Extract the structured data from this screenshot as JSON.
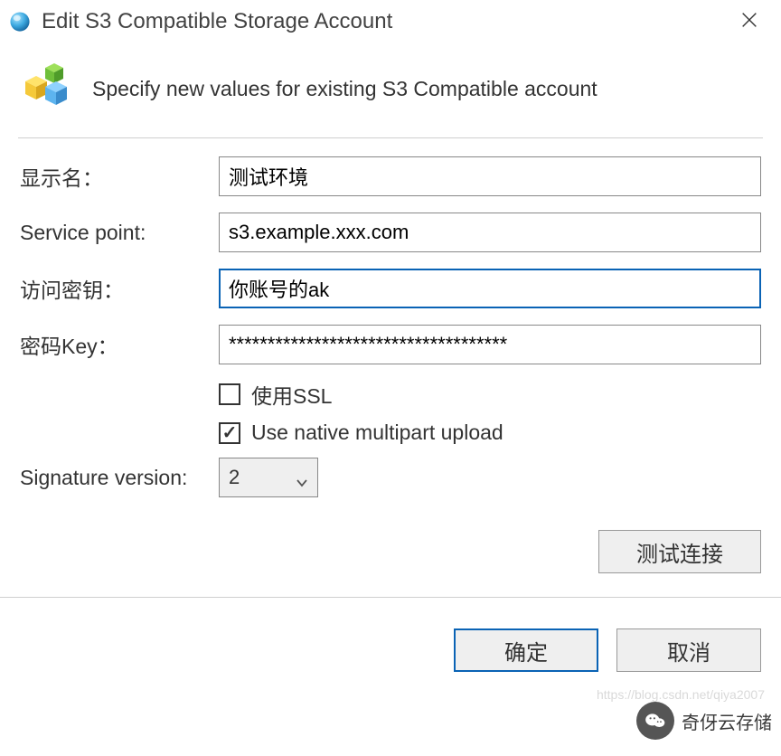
{
  "titlebar": {
    "title": "Edit S3 Compatible Storage Account"
  },
  "header": {
    "description": "Specify new values for existing S3 Compatible account"
  },
  "form": {
    "display_name": {
      "label": "显示名：",
      "value": "测试环境"
    },
    "service_point": {
      "label": "Service point:",
      "value": "s3.example.xxx.com"
    },
    "access_key": {
      "label": "访问密钥：",
      "value": "你账号的ak"
    },
    "secret_key": {
      "label": "密码Key：",
      "value": "************************************"
    },
    "use_ssl": {
      "label": "使用SSL",
      "checked": false
    },
    "native_multipart": {
      "label": "Use native multipart upload",
      "checked": true
    },
    "signature_version": {
      "label": "Signature version:",
      "value": "2"
    }
  },
  "buttons": {
    "test_connection": "测试连接",
    "ok": "确定",
    "cancel": "取消"
  },
  "watermark": {
    "brand": "奇伢云存储",
    "url": "https://blog.csdn.net/qiya2007"
  }
}
